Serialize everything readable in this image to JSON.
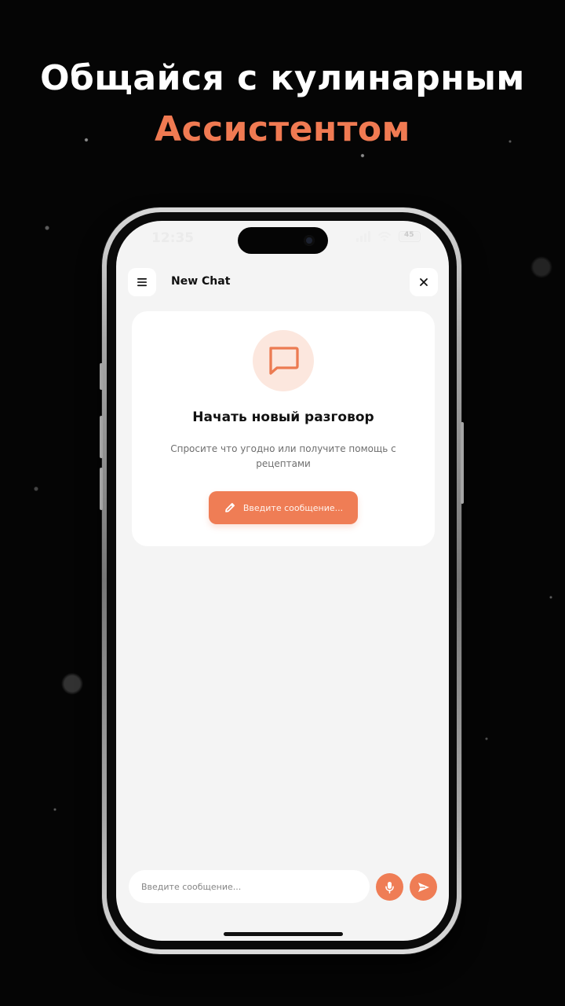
{
  "promo": {
    "headline_line1": "Общайся с кулинарным",
    "headline_line2": "Ассистентом"
  },
  "status_bar": {
    "time": "12:35",
    "battery_level": "45"
  },
  "chat_screen": {
    "title": "New Chat",
    "icons": {
      "menu": "menu-icon",
      "close": "close-icon",
      "chat": "chat-bubble-icon",
      "edit": "pencil-icon",
      "mic": "microphone-icon",
      "send": "send-icon"
    },
    "empty_state": {
      "title": "Начать новый разговор",
      "subtitle": "Спросите что угодно или получите помощь с рецептами",
      "button_label": "Введите сообщение..."
    },
    "composer": {
      "placeholder": "Введите сообщение...",
      "value": ""
    }
  },
  "colors": {
    "accent": "#ef7d55",
    "accent_soft": "#fce7de",
    "screen_background": "#f4f4f4",
    "page_background": "#050505"
  }
}
